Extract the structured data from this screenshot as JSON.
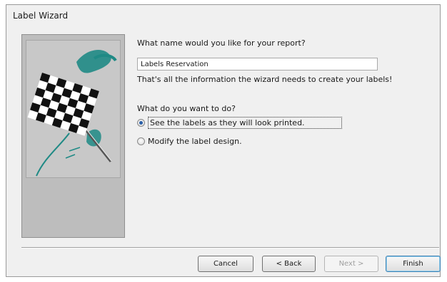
{
  "window": {
    "title": "Label Wizard"
  },
  "form": {
    "report_name_prompt": "What name would you like for your report?",
    "report_name_value": "Labels Reservation",
    "info_text": "That's all the information the wizard needs to create your labels!",
    "action_prompt": "What do you want to do?",
    "options": [
      {
        "label": "See the labels as they will look printed.",
        "checked": true
      },
      {
        "label": "Modify the label design.",
        "checked": false
      }
    ]
  },
  "buttons": {
    "cancel": "Cancel",
    "back": "< Back",
    "next": "Next >",
    "finish": "Finish",
    "next_enabled": false
  },
  "illustration": {
    "icon": "checkered-flag-icon",
    "accent_color": "#1f8a85",
    "panel_color": "#bdbdbd"
  }
}
